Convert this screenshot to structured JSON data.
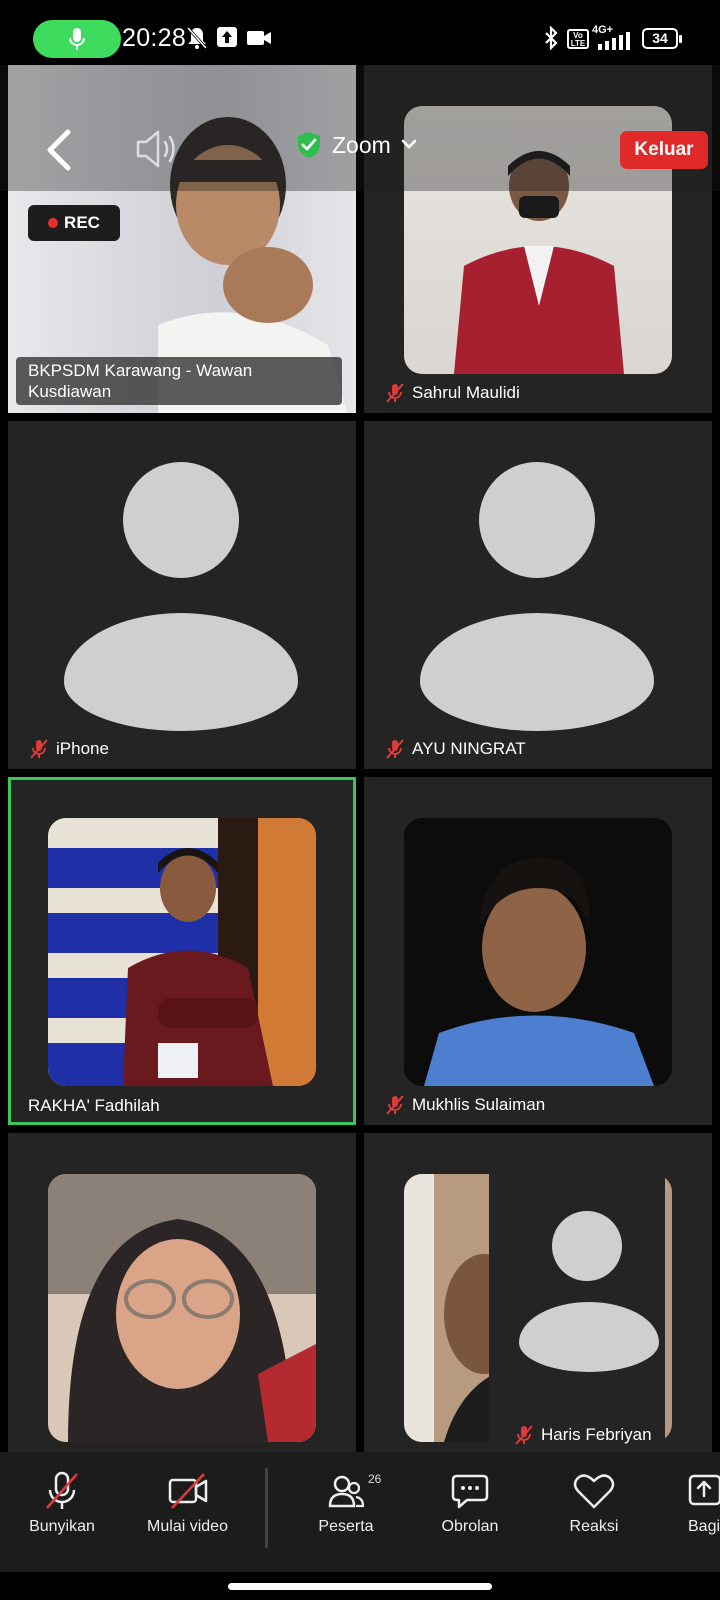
{
  "status_bar": {
    "time": "20:28",
    "network": "4G+",
    "volte": "Vo LTE",
    "battery": "34"
  },
  "header": {
    "app_title": "Zoom",
    "leave_label": "Keluar",
    "rec_label": "REC"
  },
  "participants": [
    {
      "name": "BKPSDM Karawang  - Wawan Kusdiawan",
      "muted": false
    },
    {
      "name": "Sahrul Maulidi",
      "muted": true
    },
    {
      "name": "iPhone",
      "muted": true
    },
    {
      "name": "AYU NINGRAT",
      "muted": true
    },
    {
      "name": "RAKHA' Fadhilah",
      "muted": false
    },
    {
      "name": "Mukhlis Sulaiman",
      "muted": true
    },
    {
      "name": "Haris Febriyan",
      "muted": true
    }
  ],
  "toolbar": {
    "unmute_label": "Bunyikan",
    "video_label": "Mulai video",
    "participants_label": "Peserta",
    "participants_count": "26",
    "chat_label": "Obrolan",
    "reactions_label": "Reaksi",
    "share_label": "Bagi"
  },
  "colors": {
    "active_speaker_border": "#3bc65a",
    "leave_button": "#e02a2a",
    "mic_pill": "#3ddc5f",
    "muted_icon": "#e03a3a"
  }
}
